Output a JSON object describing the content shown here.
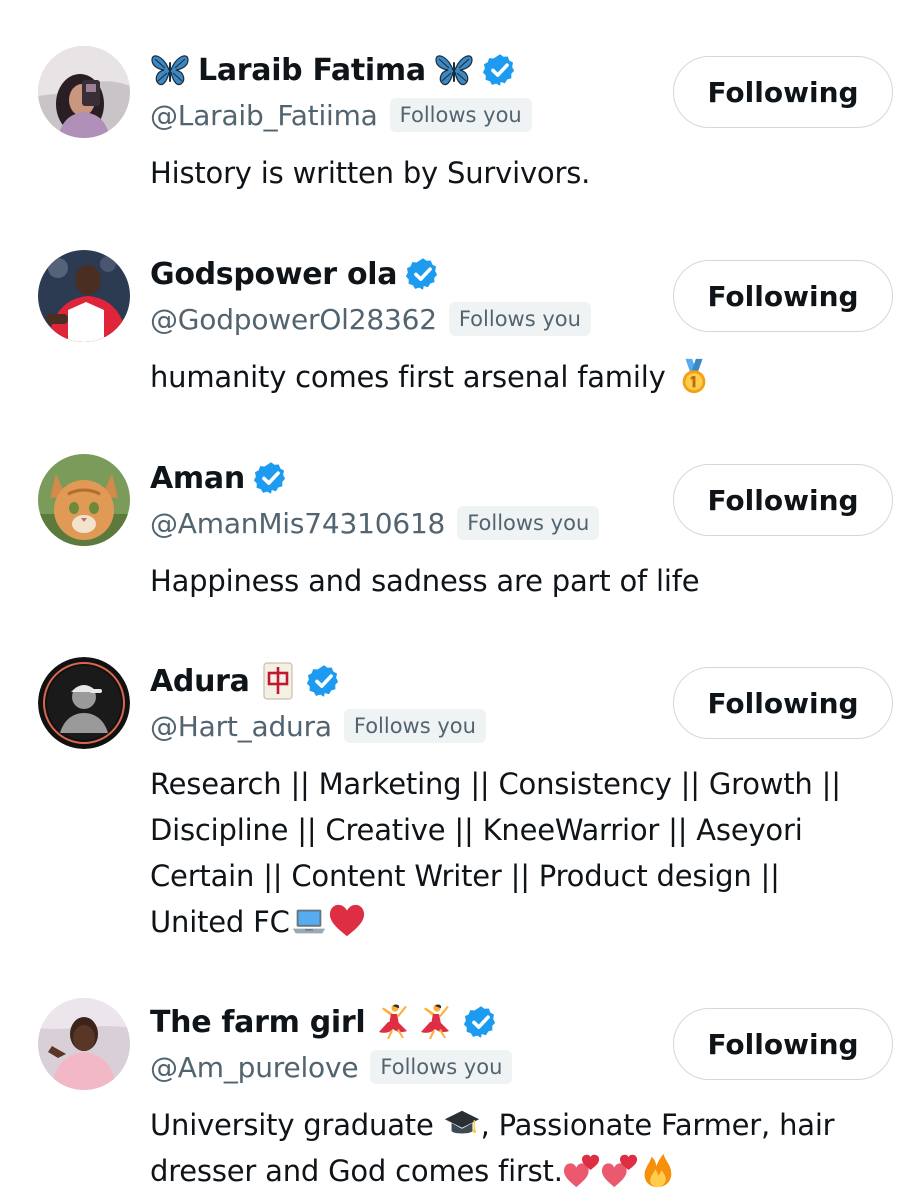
{
  "users": [
    {
      "name": "Laraib Fatima",
      "name_prefix_emoji": "butterfly",
      "name_suffix_emoji": "butterfly",
      "handle": "@Laraib_Fatiima",
      "follows_you": "Follows you",
      "bio": "History is written by Survivors.",
      "button": "Following",
      "verified": true
    },
    {
      "name": "Godspower ola",
      "handle": "@GodpowerOl28362",
      "follows_you": "Follows you",
      "bio": "humanity comes first arsenal family",
      "bio_emoji": "gold-medal",
      "button": "Following",
      "verified": true
    },
    {
      "name": "Aman",
      "handle": "@AmanMis74310618",
      "follows_you": "Follows you",
      "bio": "Happiness and sadness are part of life",
      "button": "Following",
      "verified": true
    },
    {
      "name": "Adura",
      "name_suffix_emoji": "mahjong-red-dragon",
      "handle": "@Hart_adura",
      "follows_you": "Follows you",
      "bio_lines": [
        "Research || Marketing || Consistency || Growth ||",
        "Discipline || Creative || KneeWarrior || Aseyori",
        "Certain || Content Writer || Product design ||",
        "United FC"
      ],
      "bio_emojis": [
        "laptop",
        "red-heart"
      ],
      "button": "Following",
      "verified": true
    },
    {
      "name": "The farm girl",
      "name_suffix_emojis": [
        "woman-dancing",
        "woman-dancing"
      ],
      "handle": "@Am_purelove",
      "follows_you": "Follows you",
      "bio_part1": "University graduate",
      "bio_emoji1": "graduation-cap",
      "bio_part2": ", Passionate Farmer, hair",
      "bio_line2": "dresser and God comes first.",
      "bio_emojis_end": [
        "two-hearts",
        "two-hearts",
        "fire"
      ],
      "button": "Following",
      "verified": true
    }
  ],
  "colors": {
    "verified_blue": "#1d9bf0",
    "text_primary": "#0f1419",
    "text_secondary": "#536471",
    "badge_bg": "#eff3f4",
    "button_border": "#cfd9de"
  }
}
